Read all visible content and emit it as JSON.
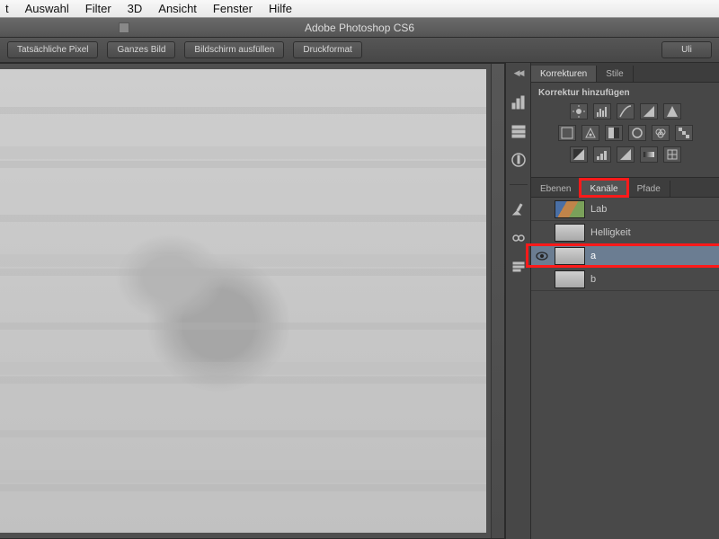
{
  "menubar": [
    "t",
    "Auswahl",
    "Filter",
    "3D",
    "Ansicht",
    "Fenster",
    "Hilfe"
  ],
  "app_title": "Adobe Photoshop CS6",
  "options_bar": {
    "buttons": [
      "Tatsächliche Pixel",
      "Ganzes Bild",
      "Bildschirm ausfüllen",
      "Druckformat"
    ],
    "user_label": "Uli"
  },
  "panels": {
    "corrections": {
      "tabs": [
        "Korrekturen",
        "Stile"
      ],
      "active_tab": 0,
      "heading": "Korrektur hinzufügen"
    },
    "channels": {
      "tabs": [
        "Ebenen",
        "Kanäle",
        "Pfade"
      ],
      "active_tab": 1,
      "items": [
        {
          "name": "Lab",
          "visible": false,
          "selected": false,
          "color_thumb": true
        },
        {
          "name": "Helligkeit",
          "visible": false,
          "selected": false,
          "color_thumb": false
        },
        {
          "name": "a",
          "visible": true,
          "selected": true,
          "color_thumb": false
        },
        {
          "name": "b",
          "visible": false,
          "selected": false,
          "color_thumb": false
        }
      ]
    }
  }
}
